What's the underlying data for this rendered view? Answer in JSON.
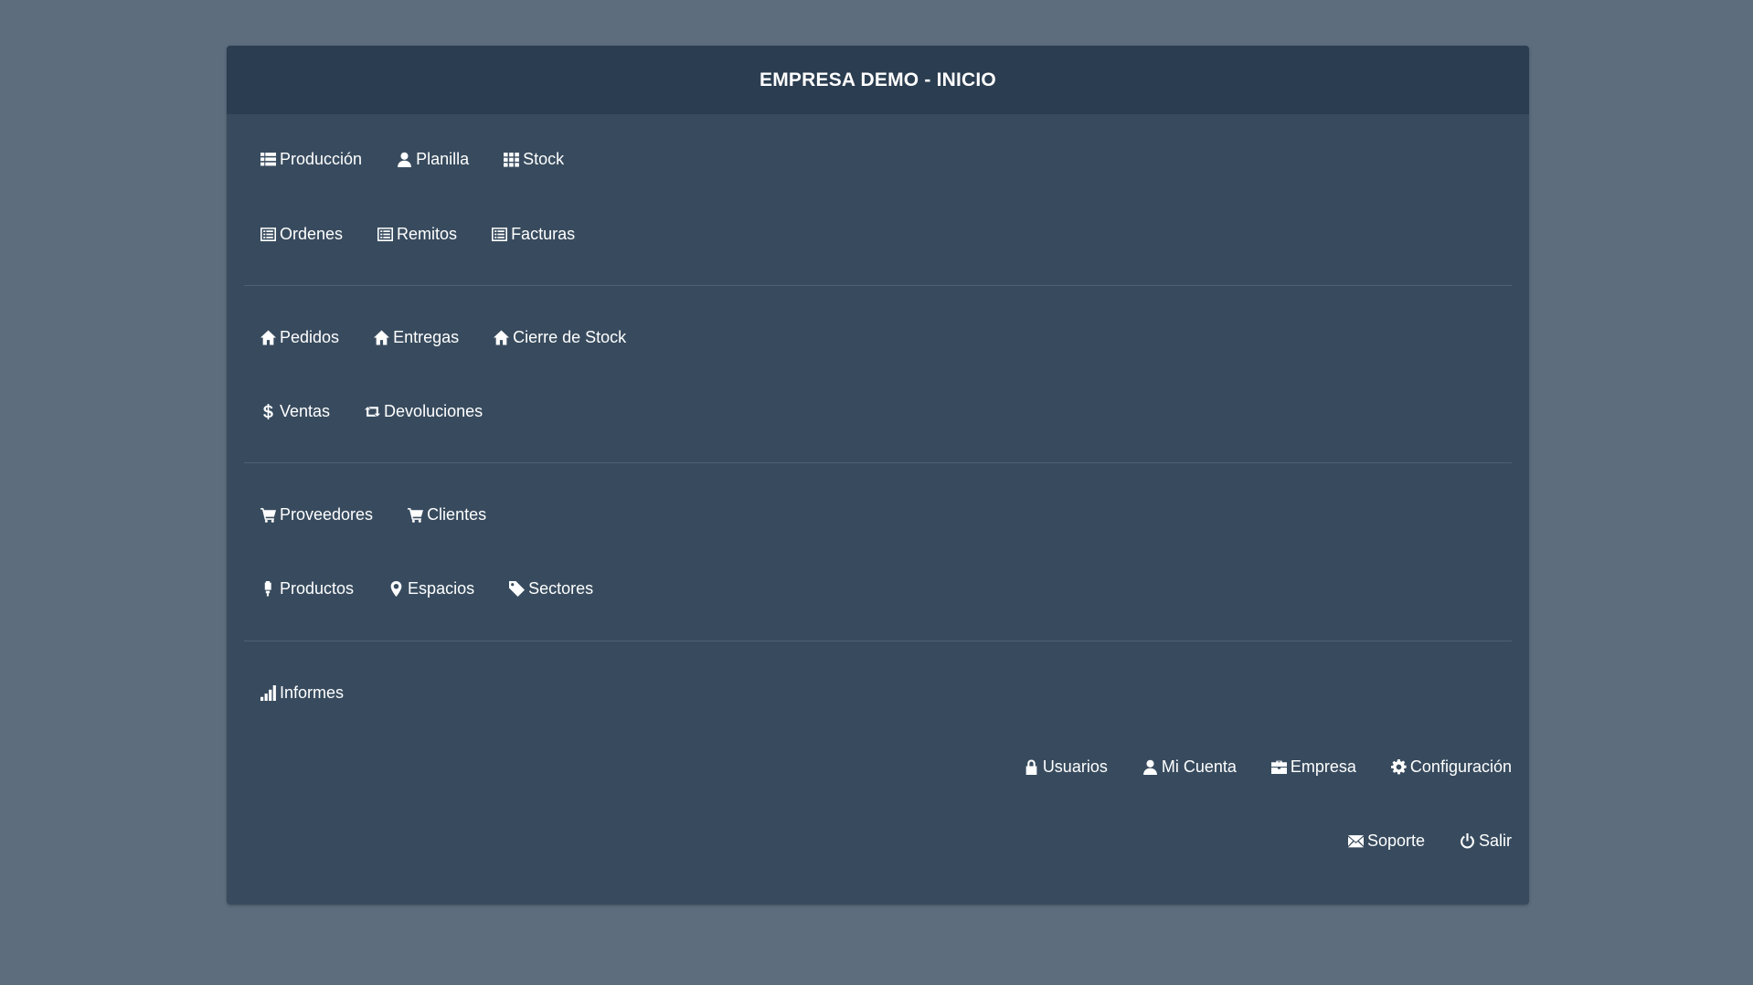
{
  "header": {
    "title": "EMPRESA DEMO - INICIO"
  },
  "groups": [
    {
      "rows": [
        [
          {
            "label": "Producción",
            "icon": "list-icon"
          },
          {
            "label": "Planilla",
            "icon": "user-icon"
          },
          {
            "label": "Stock",
            "icon": "grid-icon"
          }
        ],
        [
          {
            "label": "Ordenes",
            "icon": "list-alt-icon"
          },
          {
            "label": "Remitos",
            "icon": "list-alt-icon"
          },
          {
            "label": "Facturas",
            "icon": "list-alt-icon"
          }
        ]
      ]
    },
    {
      "rows": [
        [
          {
            "label": "Pedidos",
            "icon": "home-icon"
          },
          {
            "label": "Entregas",
            "icon": "home-icon"
          },
          {
            "label": "Cierre de Stock",
            "icon": "home-icon"
          }
        ],
        [
          {
            "label": "Ventas",
            "icon": "dollar-icon"
          },
          {
            "label": "Devoluciones",
            "icon": "retweet-icon"
          }
        ]
      ]
    },
    {
      "rows": [
        [
          {
            "label": "Proveedores",
            "icon": "cart-icon"
          },
          {
            "label": "Clientes",
            "icon": "cart-icon"
          }
        ],
        [
          {
            "label": "Productos",
            "icon": "lamp-icon"
          },
          {
            "label": "Espacios",
            "icon": "map-marker-icon"
          },
          {
            "label": "Sectores",
            "icon": "tag-icon"
          }
        ]
      ]
    },
    {
      "rows": [
        [
          {
            "label": "Informes",
            "icon": "signal-icon"
          }
        ]
      ]
    }
  ],
  "account_nav": [
    [
      {
        "label": "Usuarios",
        "icon": "lock-icon"
      },
      {
        "label": "Mi Cuenta",
        "icon": "user-icon"
      },
      {
        "label": "Empresa",
        "icon": "briefcase-icon"
      },
      {
        "label": "Configuración",
        "icon": "cog-icon"
      }
    ],
    [
      {
        "label": "Soporte",
        "icon": "envelope-icon"
      },
      {
        "label": "Salir",
        "icon": "power-icon"
      }
    ]
  ]
}
